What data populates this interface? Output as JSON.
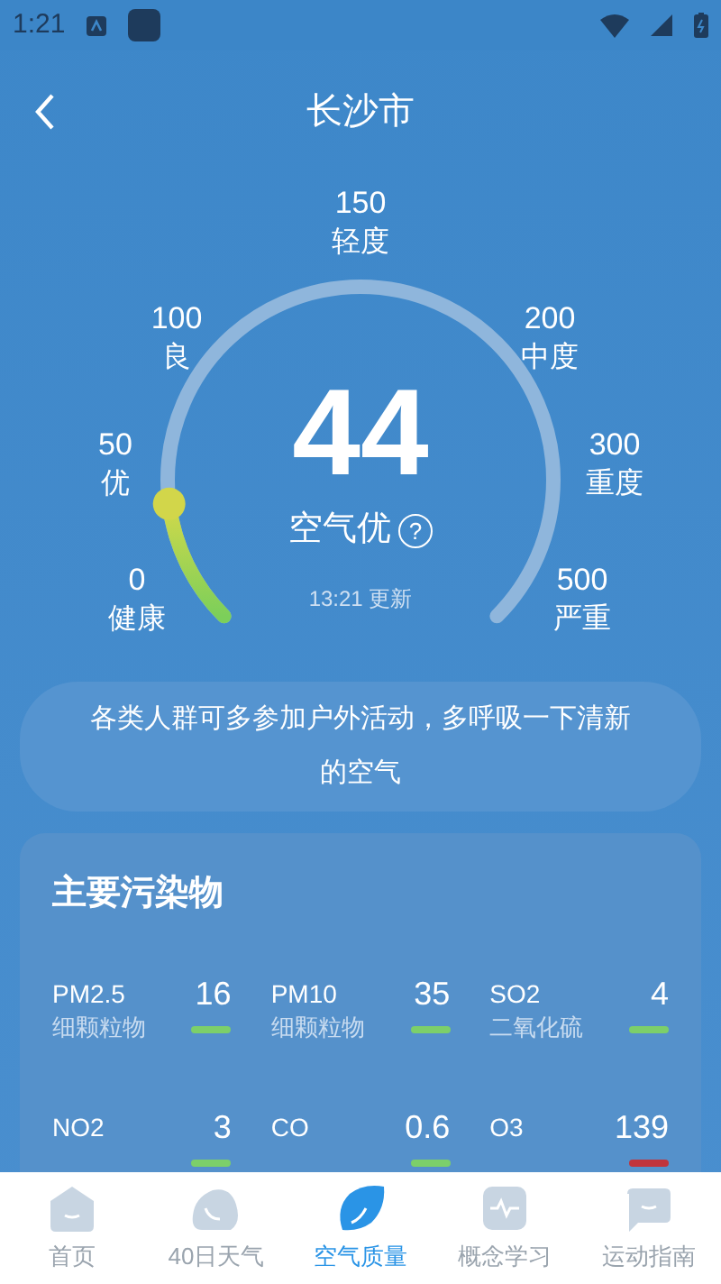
{
  "status_bar": {
    "time": "1:21"
  },
  "header": {
    "title": "长沙市"
  },
  "gauge": {
    "value": "44",
    "quality": "空气优",
    "help": "?",
    "updated": "13:21 更新",
    "level": 0.14,
    "scale": [
      {
        "number": "0",
        "label": "健康"
      },
      {
        "number": "50",
        "label": "优"
      },
      {
        "number": "100",
        "label": "良"
      },
      {
        "number": "150",
        "label": "轻度"
      },
      {
        "number": "200",
        "label": "中度"
      },
      {
        "number": "300",
        "label": "重度"
      },
      {
        "number": "500",
        "label": "严重"
      }
    ]
  },
  "advice": "各类人群可多参加户外活动，多呼吸一下清新的空气",
  "pollutants": {
    "title": "主要污染物",
    "items": [
      {
        "code": "PM2.5",
        "name": "细颗粒物",
        "value": "16",
        "color": "#7ccf6a"
      },
      {
        "code": "PM10",
        "name": "细颗粒物",
        "value": "35",
        "color": "#7ccf6a"
      },
      {
        "code": "SO2",
        "name": "二氧化硫",
        "value": "4",
        "color": "#7ccf6a"
      },
      {
        "code": "NO2",
        "value": "3",
        "color": "#7ccf6a"
      },
      {
        "code": "CO",
        "value": "0.6",
        "color": "#7ccf6a"
      },
      {
        "code": "O3",
        "value": "139",
        "color": "#c0343c"
      }
    ]
  },
  "nav": [
    {
      "label": "首页",
      "kind": "home",
      "selected": false
    },
    {
      "label": "40日天气",
      "kind": "weather",
      "selected": false
    },
    {
      "label": "空气质量",
      "kind": "air",
      "selected": true
    },
    {
      "label": "概念学习",
      "kind": "learn",
      "selected": false
    },
    {
      "label": "运动指南",
      "kind": "sport",
      "selected": false
    }
  ]
}
